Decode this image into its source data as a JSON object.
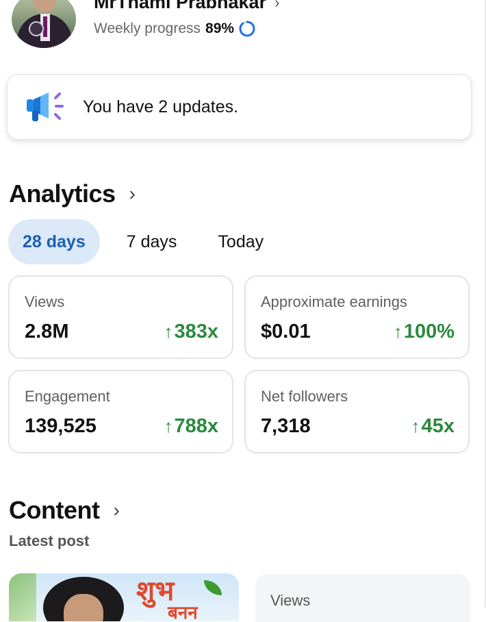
{
  "profile": {
    "name": "MrThami Prabhakar",
    "progress_label": "Weekly progress",
    "progress_value": "89%",
    "progress_fraction": 0.89,
    "progress_color": "#1a73e8"
  },
  "updates": {
    "text": "You have 2 updates.",
    "icon": "megaphone-icon"
  },
  "analytics": {
    "title": "Analytics",
    "tabs": [
      {
        "label": "28 days",
        "active": true
      },
      {
        "label": "7 days",
        "active": false
      },
      {
        "label": "Today",
        "active": false
      }
    ],
    "stats": [
      {
        "label": "Views",
        "value": "2.8M",
        "delta": "383x"
      },
      {
        "label": "Approximate earnings",
        "value": "$0.01",
        "delta": "100%"
      },
      {
        "label": "Engagement",
        "value": "139,525",
        "delta": "788x"
      },
      {
        "label": "Net followers",
        "value": "7,318",
        "delta": "45x"
      }
    ],
    "delta_color": "#2b8a3e",
    "tab_active_bg": "#dbe9f8",
    "tab_active_color": "#1a5fb4"
  },
  "content": {
    "title": "Content",
    "latest_post_label": "Latest post",
    "thumb_text_1": "शुभ",
    "thumb_text_2": "बनन",
    "views_label": "Views"
  }
}
